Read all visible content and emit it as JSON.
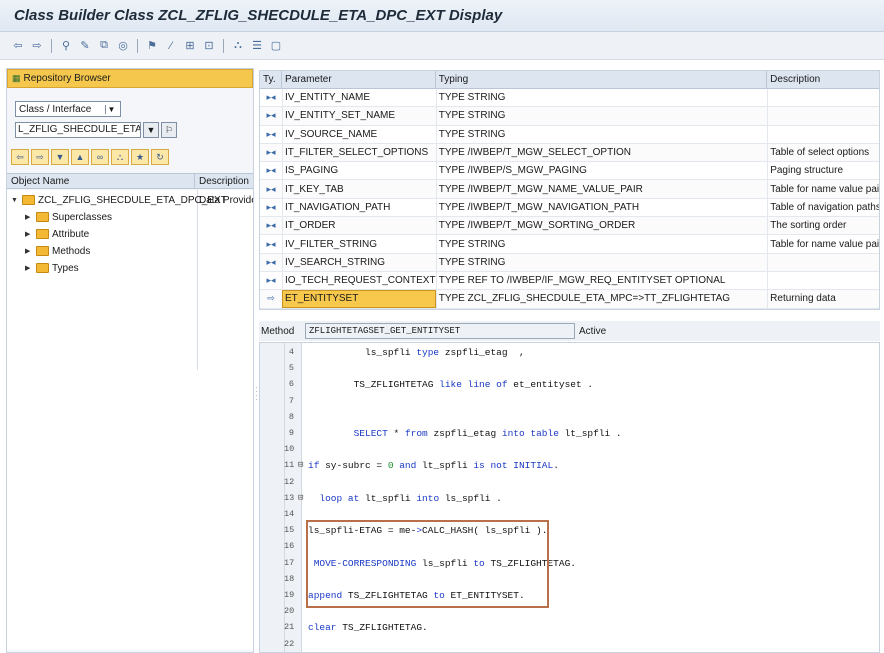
{
  "window": {
    "title": "Class Builder Class ZCL_ZFLIG_SHECDULE_ETA_DPC_EXT Display"
  },
  "toolbar": {
    "icons": [
      "back-arrow-icon",
      "forward-arrow-icon",
      "other-object-icon",
      "display-change-icon",
      "active-inactive-icon",
      "check-icon",
      "activate-icon",
      "where-used-icon",
      "object-list-icon",
      "display-object-list-icon",
      "hierarchy-icon",
      "layout-icon",
      "help-icon"
    ]
  },
  "left": {
    "header": "Repository Browser",
    "object_type": "Class / Interface",
    "object_name": "L_ZFLIG_SHECDULE_ETA_DPC_E X",
    "columns": [
      "Object Name",
      "Description"
    ],
    "tree": {
      "root": {
        "name": "ZCL_ZFLIG_SHECDULE_ETA_DPC_EXT",
        "description": "Data Provider Se"
      },
      "children": [
        "Superclasses",
        "Attribute",
        "Methods",
        "Types"
      ]
    }
  },
  "params": {
    "columns": [
      "Ty.",
      "Parameter",
      "Typing",
      "Description"
    ],
    "rows": [
      {
        "param": "IV_ENTITY_NAME",
        "typing": "TYPE STRING",
        "desc": ""
      },
      {
        "param": "IV_ENTITY_SET_NAME",
        "typing": "TYPE STRING",
        "desc": ""
      },
      {
        "param": "IV_SOURCE_NAME",
        "typing": "TYPE STRING",
        "desc": ""
      },
      {
        "param": "IT_FILTER_SELECT_OPTIONS",
        "typing": "TYPE /IWBEP/T_MGW_SELECT_OPTION",
        "desc": "Table of select options"
      },
      {
        "param": "IS_PAGING",
        "typing": "TYPE /IWBEP/S_MGW_PAGING",
        "desc": "Paging structure"
      },
      {
        "param": "IT_KEY_TAB",
        "typing": "TYPE /IWBEP/T_MGW_NAME_VALUE_PAIR",
        "desc": "Table for name value pairs"
      },
      {
        "param": "IT_NAVIGATION_PATH",
        "typing": "TYPE /IWBEP/T_MGW_NAVIGATION_PATH",
        "desc": "Table of navigation paths"
      },
      {
        "param": "IT_ORDER",
        "typing": "TYPE /IWBEP/T_MGW_SORTING_ORDER",
        "desc": "The sorting order"
      },
      {
        "param": "IV_FILTER_STRING",
        "typing": "TYPE STRING",
        "desc": "Table for name value pairs"
      },
      {
        "param": "IV_SEARCH_STRING",
        "typing": "TYPE STRING",
        "desc": ""
      },
      {
        "param": "IO_TECH_REQUEST_CONTEXT",
        "typing": "TYPE REF TO /IWBEP/IF_MGW_REQ_ENTITYSET OPTIONAL",
        "desc": ""
      },
      {
        "param": "ET_ENTITYSET",
        "typing": "TYPE ZCL_ZFLIG_SHECDULE_ETA_MPC=>TT_ZFLIGHTETAG",
        "desc": "Returning data"
      }
    ]
  },
  "method": {
    "label": "Method",
    "name": "ZFLIGHTETAGSET_GET_ENTITYSET",
    "status": "Active"
  },
  "code": {
    "lines": [
      {
        "n": "4",
        "t": "          ls_spfli type zspfli_etag  ,"
      },
      {
        "n": "5",
        "t": ""
      },
      {
        "n": "6",
        "t": "        TS_ZFLIGHTETAG like line of et_entityset ."
      },
      {
        "n": "7",
        "t": ""
      },
      {
        "n": "8",
        "t": ""
      },
      {
        "n": "9",
        "t": "        SELECT * from zspfli_etag into table lt_spfli ."
      },
      {
        "n": "10",
        "t": ""
      },
      {
        "n": "11",
        "t": "if sy-subrc = 0 and lt_spfli is not INITIAL."
      },
      {
        "n": "12",
        "t": ""
      },
      {
        "n": "13",
        "t": "  loop at lt_spfli into ls_spfli ."
      },
      {
        "n": "14",
        "t": ""
      },
      {
        "n": "15",
        "t": "ls_spfli-ETAG = me->CALC_HASH( ls_spfli )."
      },
      {
        "n": "16",
        "t": ""
      },
      {
        "n": "17",
        "t": " MOVE-CORRESPONDING ls_spfli to TS_ZFLIGHTETAG."
      },
      {
        "n": "18",
        "t": ""
      },
      {
        "n": "19",
        "t": "append TS_ZFLIGHTETAG to ET_ENTITYSET."
      },
      {
        "n": "20",
        "t": ""
      },
      {
        "n": "21",
        "t": "clear TS_ZFLIGHTETAG."
      },
      {
        "n": "22",
        "t": ""
      }
    ]
  }
}
